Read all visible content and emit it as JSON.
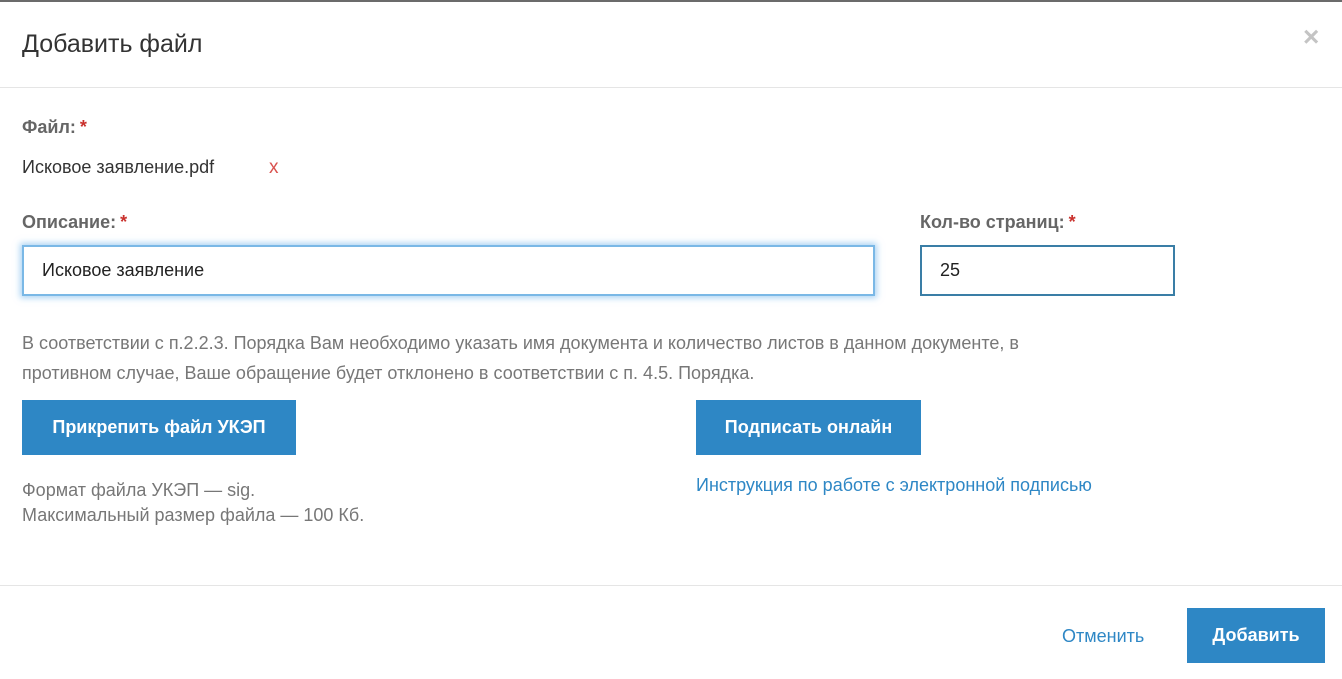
{
  "dialog": {
    "title": "Добавить файл",
    "close_icon": "×"
  },
  "file": {
    "label": "Файл:",
    "required_mark": "*",
    "name": "Исковое заявление.pdf",
    "remove_label": "x"
  },
  "description": {
    "label": "Описание:",
    "required_mark": "*",
    "value": "Исковое заявление"
  },
  "pages": {
    "label": "Кол-во страниц:",
    "required_mark": "*",
    "value": "25"
  },
  "notice": {
    "line1": "В соответствии с п.2.2.3. Порядка Вам необходимо указать имя документа и количество листов в данном документе, в",
    "line2": "противном случае, Ваше обращение будет отклонено в соответствии с п. 4.5. Порядка."
  },
  "actions": {
    "attach_label": "Прикрепить файл УКЭП",
    "sign_online_label": "Подписать онлайн",
    "instruction_link": "Инструкция по работе с электронной подписью"
  },
  "hints": {
    "format": "Формат файла УКЭП — sig.",
    "max_size": "Максимальный размер файла — 100 Кб."
  },
  "footer": {
    "cancel_label": "Отменить",
    "add_label": "Добавить"
  },
  "colors": {
    "primary": "#2e87c5",
    "required": "#c9302c",
    "remove": "#d9534f",
    "focus_border": "#66afe9"
  }
}
